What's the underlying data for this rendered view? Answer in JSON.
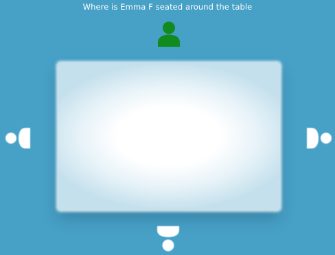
{
  "question": {
    "text": "Where is Emma F seated around the table"
  },
  "colors": {
    "background": "#47a0c6",
    "occupied_seat": "#118a1e",
    "empty_seat": "#ffffff",
    "table": "#ffffff"
  },
  "seats": [
    {
      "position": "top",
      "icon": "person-icon",
      "occupied": true
    },
    {
      "position": "left",
      "icon": "empty-seat-icon",
      "occupied": false
    },
    {
      "position": "right",
      "icon": "empty-seat-icon",
      "occupied": false
    },
    {
      "position": "bottom",
      "icon": "empty-seat-icon",
      "occupied": false
    }
  ]
}
